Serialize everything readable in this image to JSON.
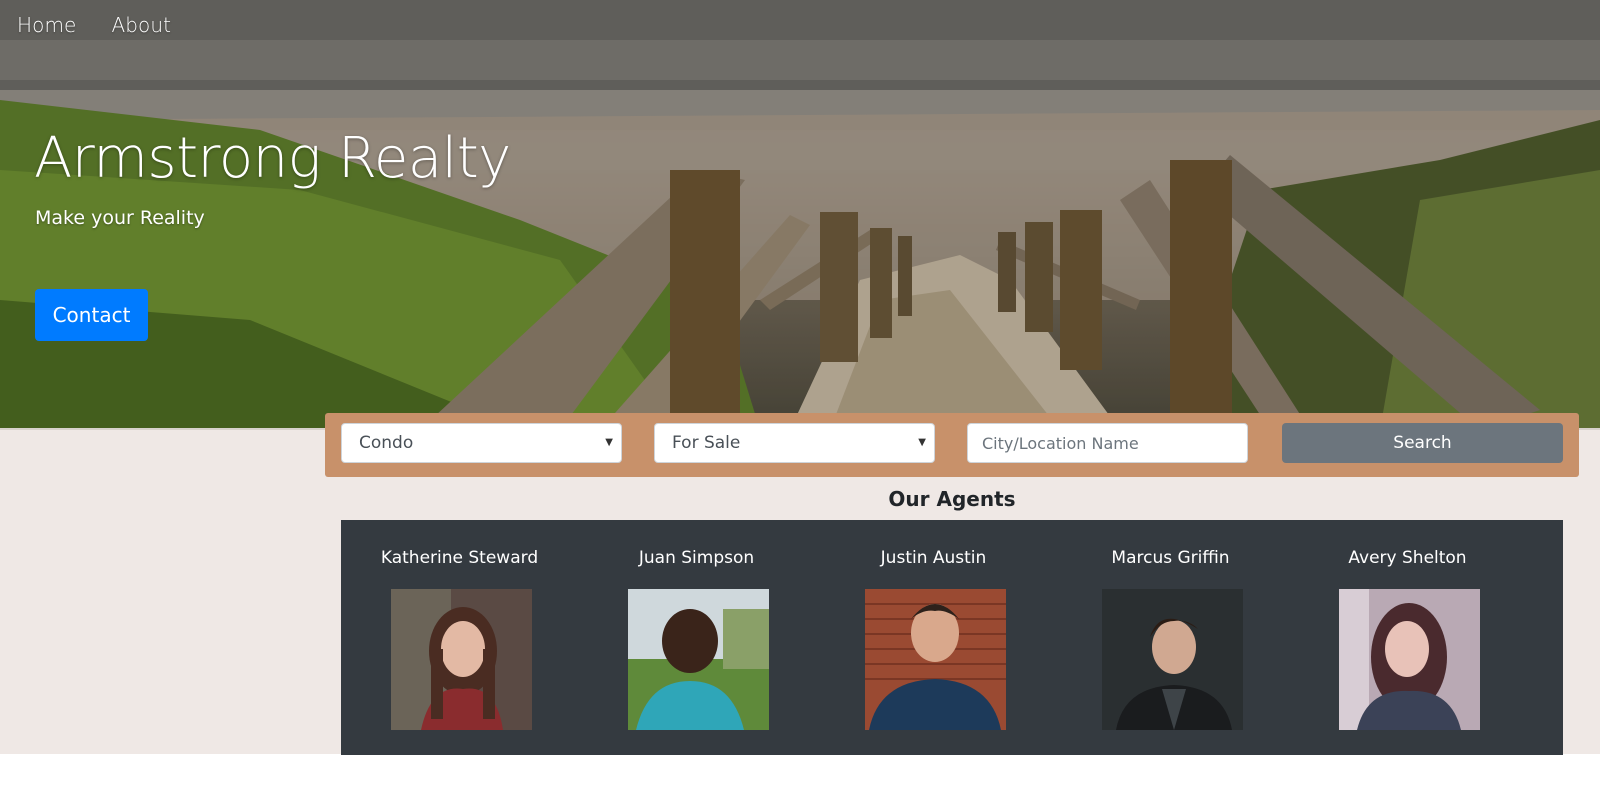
{
  "nav": {
    "items": [
      {
        "label": "Home"
      },
      {
        "label": "About"
      }
    ]
  },
  "hero": {
    "title": "Armstrong Realty",
    "subtitle": "Make your Reality",
    "contact_label": "Contact"
  },
  "search": {
    "property_type": {
      "selected": "Condo"
    },
    "listing_status": {
      "selected": "For Sale"
    },
    "location": {
      "value": "",
      "placeholder": "City/Location Name"
    },
    "search_label": "Search"
  },
  "agents": {
    "heading": "Our Agents",
    "list": [
      {
        "name": "Katherine Steward"
      },
      {
        "name": "Juan Simpson"
      },
      {
        "name": "Justin Austin"
      },
      {
        "name": "Marcus Griffin"
      },
      {
        "name": "Avery Shelton"
      }
    ]
  },
  "colors": {
    "primary": "#007bff",
    "secondary": "#6c757d",
    "search_bar": "#c8916a",
    "agents_panel": "#343a40",
    "page_background": "#efe8e5"
  }
}
